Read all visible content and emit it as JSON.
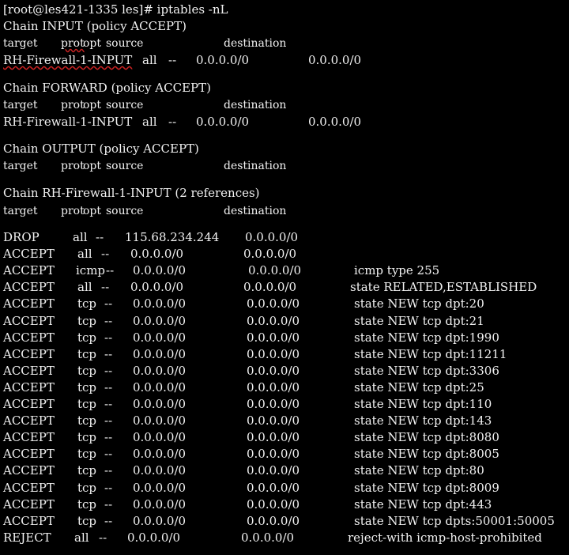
{
  "terminal": {
    "prompt": "[root@les421-1335 les]# iptables -nL",
    "chains": [
      {
        "title": "Chain INPUT (policy ACCEPT)",
        "headers": {
          "target": "target",
          "prot": "prot",
          "opt": "opt",
          "source": "source",
          "destination": "destination"
        },
        "rows": [
          {
            "target": "RH-Firewall-1-INPUT",
            "prot": "all",
            "opt": "--",
            "source": "0.0.0.0/0",
            "destination": "0.0.0.0/0",
            "extra": ""
          }
        ]
      },
      {
        "title": "Chain FORWARD (policy ACCEPT)",
        "headers": {
          "target": "target",
          "prot": "prot",
          "opt": "opt",
          "source": "source",
          "destination": "destination"
        },
        "rows": [
          {
            "target": "RH-Firewall-1-INPUT",
            "prot": "all",
            "opt": "--",
            "source": "0.0.0.0/0",
            "destination": "0.0.0.0/0",
            "extra": ""
          }
        ]
      },
      {
        "title": "Chain OUTPUT (policy ACCEPT)",
        "headers": {
          "target": "target",
          "prot": "prot",
          "opt": "opt",
          "source": "source",
          "destination": "destination"
        },
        "rows": []
      },
      {
        "title": "Chain RH-Firewall-1-INPUT (2 references)",
        "headers": {
          "target": "target",
          "prot": "prot",
          "opt": "opt",
          "source": "source",
          "destination": "destination"
        },
        "rows": [
          {
            "target": "DROP",
            "prot": "all",
            "opt": "--",
            "source": "115.68.234.244",
            "destination": "0.0.0.0/0",
            "extra": ""
          },
          {
            "target": "ACCEPT",
            "prot": "all",
            "opt": "--",
            "source": "0.0.0.0/0",
            "destination": "0.0.0.0/0",
            "extra": ""
          },
          {
            "target": "ACCEPT",
            "prot": "icmp",
            "opt": "--",
            "source": "0.0.0.0/0",
            "destination": "0.0.0.0/0",
            "extra": "icmp type 255"
          },
          {
            "target": "ACCEPT",
            "prot": "all",
            "opt": "--",
            "source": "0.0.0.0/0",
            "destination": "0.0.0.0/0",
            "extra": "state RELATED,ESTABLISHED"
          },
          {
            "target": "ACCEPT",
            "prot": "tcp",
            "opt": "--",
            "source": "0.0.0.0/0",
            "destination": "0.0.0.0/0",
            "extra": "state NEW tcp dpt:20"
          },
          {
            "target": "ACCEPT",
            "prot": "tcp",
            "opt": "--",
            "source": "0.0.0.0/0",
            "destination": "0.0.0.0/0",
            "extra": "state NEW tcp dpt:21"
          },
          {
            "target": "ACCEPT",
            "prot": "tcp",
            "opt": "--",
            "source": "0.0.0.0/0",
            "destination": "0.0.0.0/0",
            "extra": "state NEW tcp dpt:1990"
          },
          {
            "target": "ACCEPT",
            "prot": "tcp",
            "opt": "--",
            "source": "0.0.0.0/0",
            "destination": "0.0.0.0/0",
            "extra": "state NEW tcp dpt:11211"
          },
          {
            "target": "ACCEPT",
            "prot": "tcp",
            "opt": "--",
            "source": "0.0.0.0/0",
            "destination": "0.0.0.0/0",
            "extra": "state NEW tcp dpt:3306"
          },
          {
            "target": "ACCEPT",
            "prot": "tcp",
            "opt": "--",
            "source": "0.0.0.0/0",
            "destination": "0.0.0.0/0",
            "extra": "state NEW tcp dpt:25"
          },
          {
            "target": "ACCEPT",
            "prot": "tcp",
            "opt": "--",
            "source": "0.0.0.0/0",
            "destination": "0.0.0.0/0",
            "extra": "state NEW tcp dpt:110"
          },
          {
            "target": "ACCEPT",
            "prot": "tcp",
            "opt": "--",
            "source": "0.0.0.0/0",
            "destination": "0.0.0.0/0",
            "extra": "state NEW tcp dpt:143"
          },
          {
            "target": "ACCEPT",
            "prot": "tcp",
            "opt": "--",
            "source": "0.0.0.0/0",
            "destination": "0.0.0.0/0",
            "extra": "state NEW tcp dpt:8080"
          },
          {
            "target": "ACCEPT",
            "prot": "tcp",
            "opt": "--",
            "source": "0.0.0.0/0",
            "destination": "0.0.0.0/0",
            "extra": "state NEW tcp dpt:8005"
          },
          {
            "target": "ACCEPT",
            "prot": "tcp",
            "opt": "--",
            "source": "0.0.0.0/0",
            "destination": "0.0.0.0/0",
            "extra": "state NEW tcp dpt:80"
          },
          {
            "target": "ACCEPT",
            "prot": "tcp",
            "opt": "--",
            "source": "0.0.0.0/0",
            "destination": "0.0.0.0/0",
            "extra": "state NEW tcp dpt:8009"
          },
          {
            "target": "ACCEPT",
            "prot": "tcp",
            "opt": "--",
            "source": "0.0.0.0/0",
            "destination": "0.0.0.0/0",
            "extra": "state NEW tcp dpt:443"
          },
          {
            "target": "ACCEPT",
            "prot": "tcp",
            "opt": "--",
            "source": "0.0.0.0/0",
            "destination": "0.0.0.0/0",
            "extra": "state NEW tcp dpts:50001:50005"
          },
          {
            "target": "REJECT",
            "prot": "all",
            "opt": "--",
            "source": "0.0.0.0/0",
            "destination": "0.0.0.0/0",
            "extra": "reject-with icmp-host-prohibited"
          }
        ]
      }
    ]
  }
}
